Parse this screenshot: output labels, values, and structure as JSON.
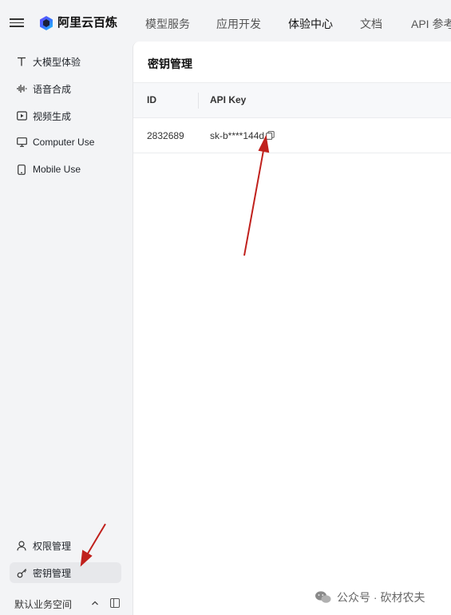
{
  "header": {
    "brand": "阿里云百炼",
    "nav": [
      "模型服务",
      "应用开发",
      "体验中心",
      "文档",
      "API 参考"
    ],
    "active_nav": "体验中心"
  },
  "sidebar": {
    "items": [
      {
        "label": "大模型体验",
        "icon": "text-t-icon"
      },
      {
        "label": "语音合成",
        "icon": "waveform-icon"
      },
      {
        "label": "视频生成",
        "icon": "video-icon"
      },
      {
        "label": "Computer Use",
        "icon": "monitor-icon"
      },
      {
        "label": "Mobile Use",
        "icon": "phone-icon"
      }
    ],
    "bottom_items": [
      {
        "label": "权限管理",
        "icon": "user-icon"
      },
      {
        "label": "密钥管理",
        "icon": "key-icon",
        "active": true
      }
    ],
    "workspace": "默认业务空间"
  },
  "main": {
    "title": "密钥管理",
    "table": {
      "columns": [
        "ID",
        "API Key"
      ],
      "rows": [
        {
          "id": "2832689",
          "api_key": "sk-b****144d"
        }
      ]
    }
  },
  "watermark": {
    "text": "公众号 · 砍材农夫"
  },
  "colors": {
    "annotation_arrow": "#c0201c",
    "active_item_bg": "#e7e8eb",
    "page_bg": "#f3f4f6"
  }
}
